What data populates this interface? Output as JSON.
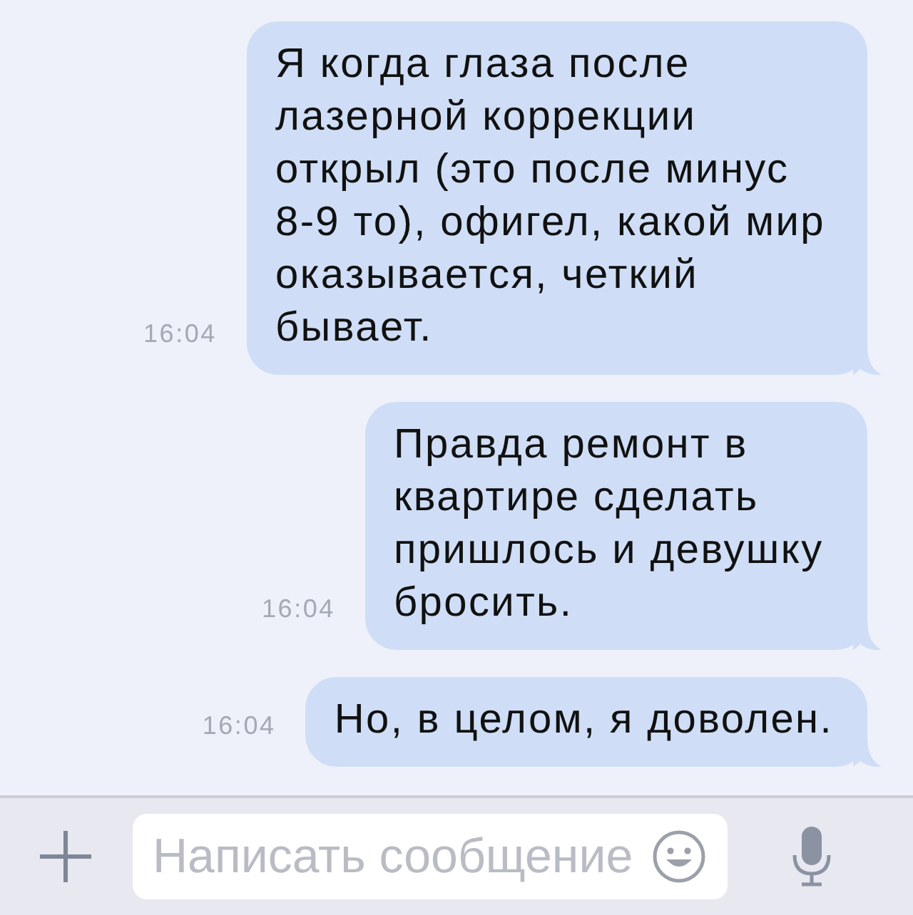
{
  "messages": [
    {
      "text": "Я когда глаза после лазерной коррекции открыл (это после минус 8-9 то), офигел, какой мир оказывается, четкий бывает.",
      "time": "16:04"
    },
    {
      "text": "Правда ремонт в квартире сделать пришлось и девушку бросить.",
      "time": "16:04"
    },
    {
      "text": "Но, в целом, я доволен.",
      "time": "16:04"
    }
  ],
  "composer": {
    "placeholder": "Написать сообщение"
  }
}
